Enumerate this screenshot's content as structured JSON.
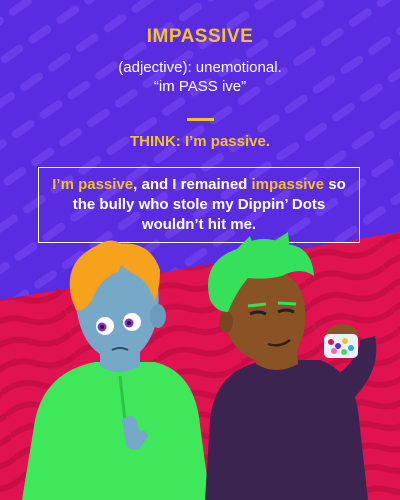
{
  "word": "IMPASSIVE",
  "definition": "(adjective): unemotional.",
  "pronunciation": "“im PASS ive”",
  "think": "THINK: I’m passive.",
  "sentence": {
    "hl1": "I’m passive",
    "mid": ", and I remained ",
    "hl2": "impassive",
    "end": " so the bully who stole my Dippin’ Dots wouldn’t hit me."
  },
  "colors": {
    "background_top": "#5a2ce0",
    "background_bottom": "#e0124f",
    "accent": "#f2c12e",
    "text": "#ffffff"
  },
  "illustration": {
    "left_figure": "blue-skinned boy with orange hair in green shirt",
    "right_figure": "green-haired boy in dark purple shirt holding a cup of Dippin Dots"
  }
}
